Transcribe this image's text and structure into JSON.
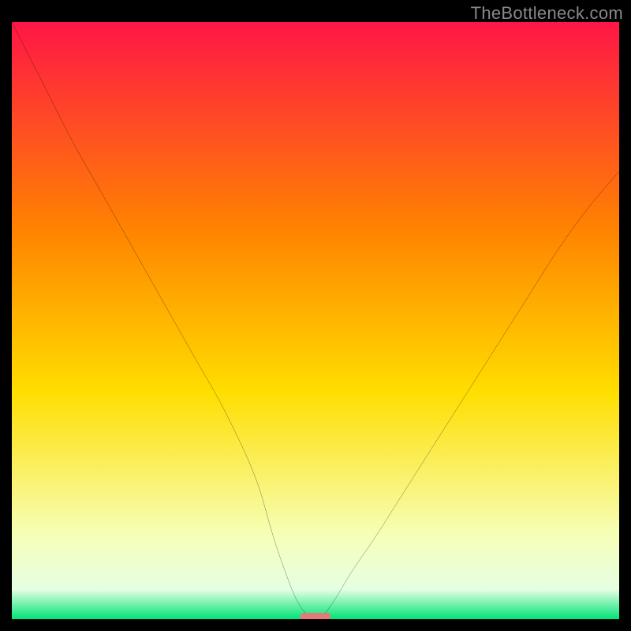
{
  "watermark": "TheBottleneck.com",
  "chart_data": {
    "type": "line",
    "title": "",
    "xlabel": "",
    "ylabel": "",
    "xlim": [
      0,
      100
    ],
    "ylim": [
      0,
      100
    ],
    "gradient_colors": {
      "top": "#ff1646",
      "upper_mid": "#ff8400",
      "mid": "#ffde00",
      "lower_mid": "#f6ffb8",
      "bottom_band": "#e6ffe3",
      "bottom": "#00e376"
    },
    "series": [
      {
        "name": "bottleneck-curve",
        "x": [
          0,
          5,
          10,
          15,
          20,
          25,
          30,
          35,
          40,
          43,
          45,
          47,
          49,
          51,
          53,
          56,
          60,
          65,
          70,
          75,
          80,
          85,
          90,
          95,
          100
        ],
        "y": [
          100,
          90,
          80,
          71,
          62,
          53,
          44,
          35,
          24,
          14,
          8,
          3,
          0.5,
          0.5,
          3,
          8,
          14,
          22,
          30,
          38,
          46,
          54,
          62,
          69,
          75
        ]
      }
    ],
    "marker": {
      "name": "optimal-marker",
      "x": 50,
      "y": 0.4,
      "width": 5,
      "color": "#e37a7a"
    }
  }
}
